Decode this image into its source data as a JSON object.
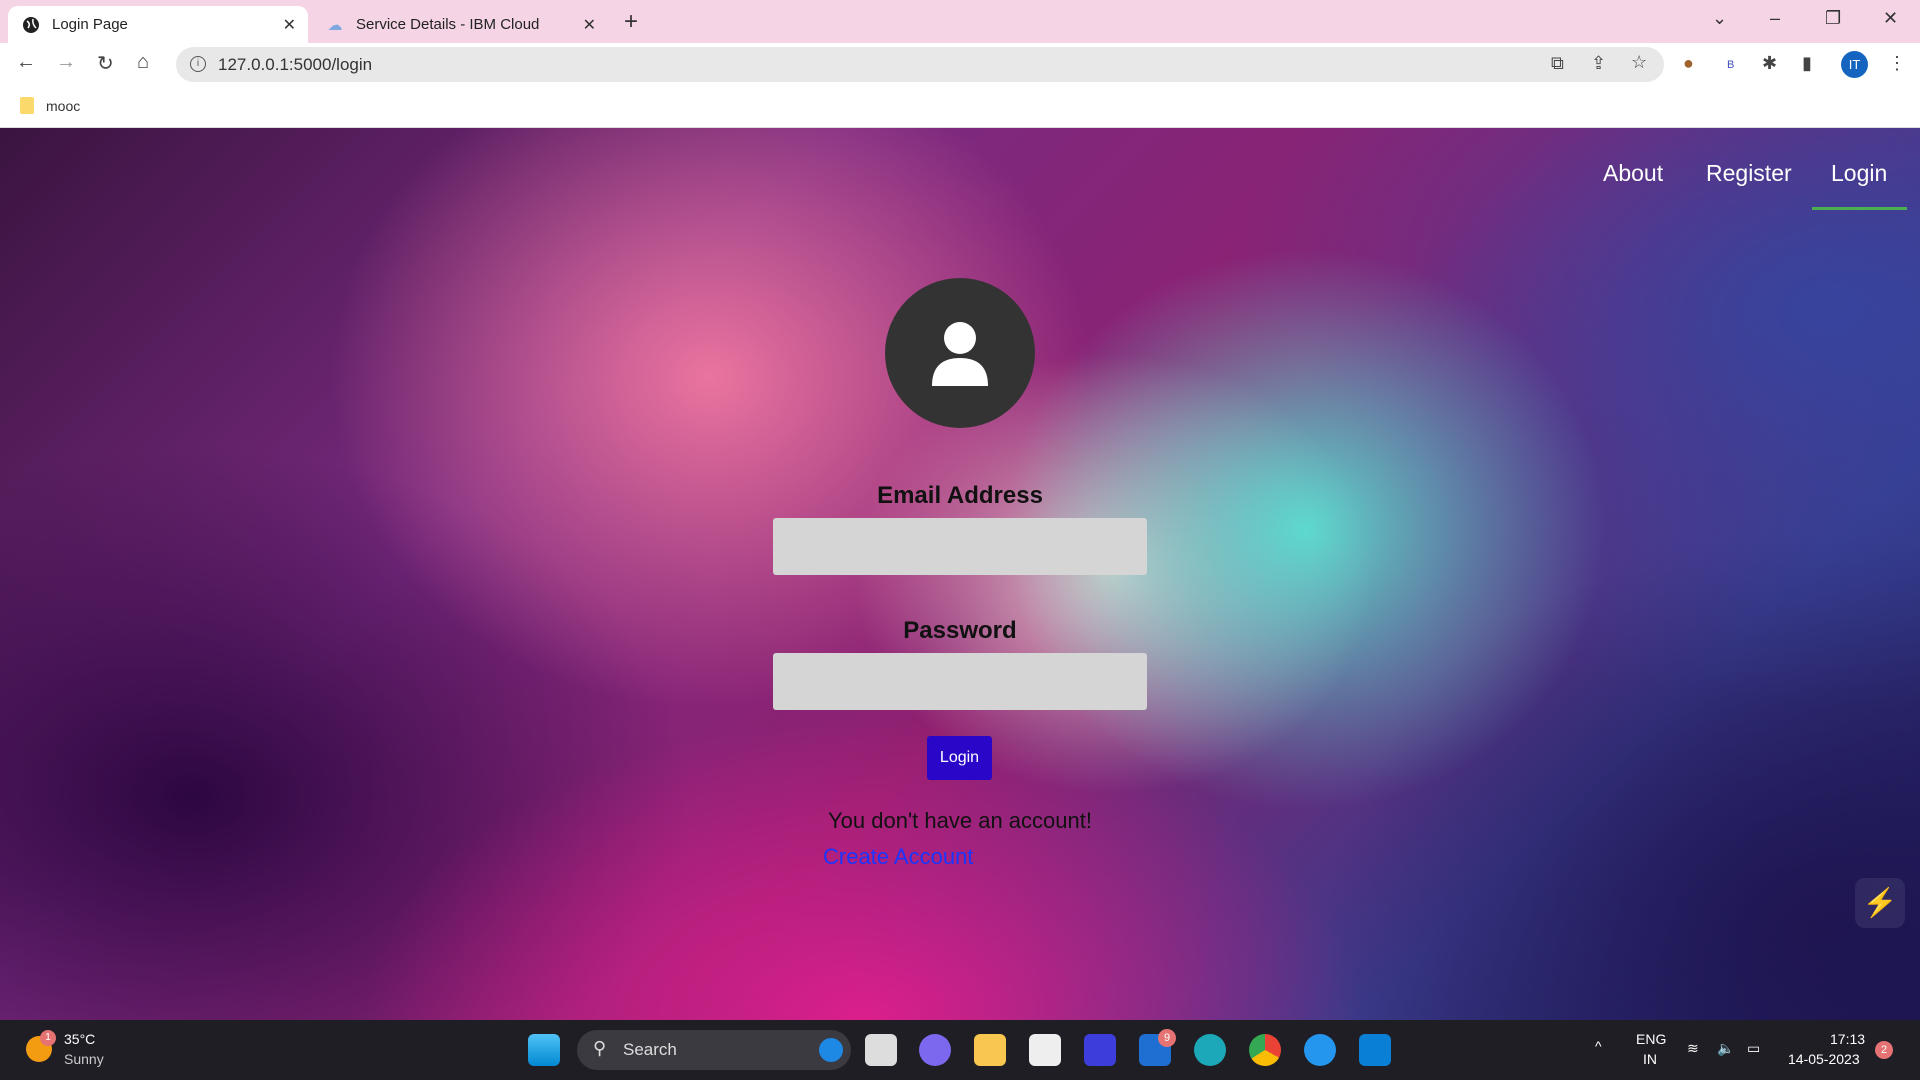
{
  "browser": {
    "tabs": [
      {
        "title": "Login Page",
        "close": "✕"
      },
      {
        "title": "Service Details - IBM Cloud",
        "close": "✕"
      }
    ],
    "new_tab": "+",
    "url": "127.0.0.1:5000/login",
    "bookmark": "mooc",
    "profile": "IT",
    "ext_b": "B"
  },
  "nav": {
    "about": "About",
    "register": "Register",
    "login": "Login"
  },
  "form": {
    "email_label": "Email Address",
    "email_value": "",
    "password_label": "Password",
    "password_value": "",
    "login_button": "Login",
    "no_account": "You don't have an account!",
    "create_account": "Create Account"
  },
  "taskbar": {
    "weather_temp": "35°C",
    "weather_desc": "Sunny",
    "weather_badge": "1",
    "search": "Search",
    "mail_badge": "9",
    "lang1": "ENG",
    "lang2": "IN",
    "time": "17:13",
    "date": "14-05-2023",
    "notif": "2"
  }
}
